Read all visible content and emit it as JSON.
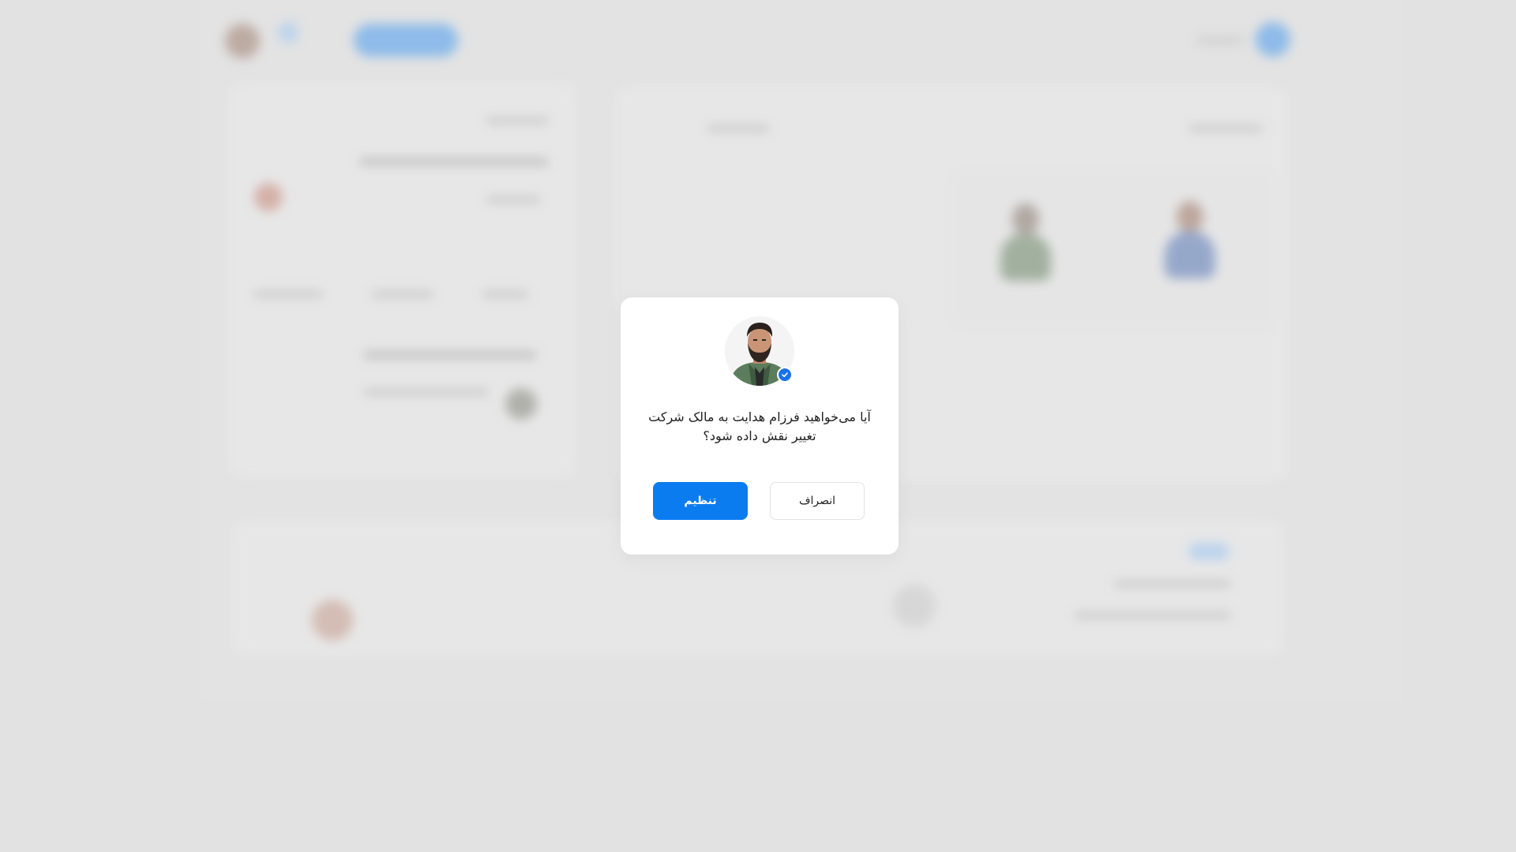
{
  "dialog": {
    "message": "آیا می‌خواهید فرزام هدایت به مالک شرکت تغییر نقش داده شود؟",
    "confirm_label": "تنظیم",
    "cancel_label": "انصراف",
    "avatar_icon": "user-avatar",
    "badge_icon": "verified-check-icon"
  },
  "colors": {
    "primary": "#0a7cf0",
    "verified": "#1a73e8",
    "backdrop": "#e3e3e3"
  }
}
